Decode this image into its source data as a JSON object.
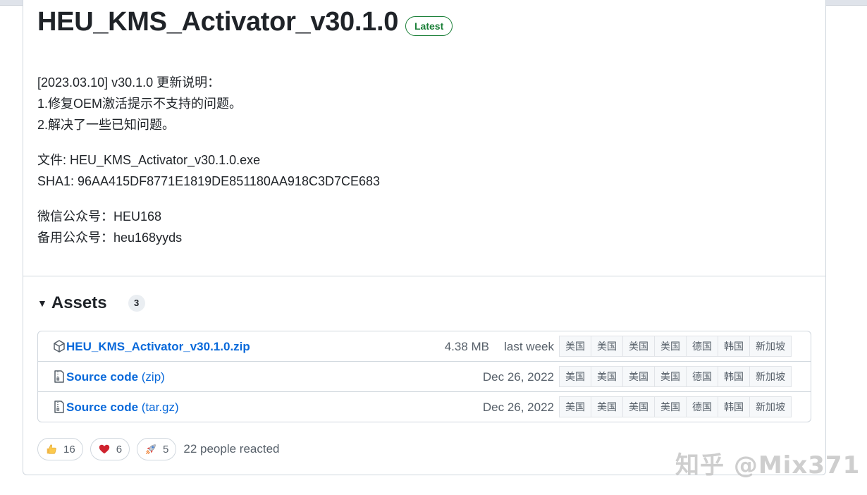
{
  "release": {
    "title": "HEU_KMS_Activator_v30.1.0",
    "badge": "Latest",
    "notes": [
      [
        "[2023.03.10] v30.1.0 更新说明：",
        "1.修复OEM激活提示不支持的问题。",
        "2.解决了一些已知问题。"
      ],
      [
        "文件: HEU_KMS_Activator_v30.1.0.exe",
        "SHA1: 96AA415DF8771E1819DE851180AA918C3D7CE683"
      ],
      [
        "微信公众号：HEU168",
        "备用公众号：heu168yyds"
      ]
    ]
  },
  "assets": {
    "label": "Assets",
    "count": "3",
    "rows": [
      {
        "icon": "package-icon",
        "name": "HEU_KMS_Activator_v30.1.0.zip",
        "suffix": "",
        "size": "4.38 MB",
        "date": "last week"
      },
      {
        "icon": "file-zip-icon",
        "name": "Source code",
        "suffix": " (zip)",
        "size": "",
        "date": "Dec 26, 2022"
      },
      {
        "icon": "file-zip-icon",
        "name": "Source code",
        "suffix": " (tar.gz)",
        "size": "",
        "date": "Dec 26, 2022"
      }
    ],
    "mirrors": [
      "美国",
      "美国",
      "美国",
      "美国",
      "德国",
      "韩国",
      "新加坡"
    ]
  },
  "reactions": {
    "items": [
      {
        "icon": "thumbs-up-icon",
        "count": "16"
      },
      {
        "icon": "heart-icon",
        "count": "6"
      },
      {
        "icon": "rocket-icon",
        "count": "5"
      }
    ],
    "summary": "22 people reacted"
  },
  "watermark": "知乎 @Mix371",
  "colors": {
    "link": "#0969da",
    "latest": "#1a7f37",
    "heart": "#cf222e"
  }
}
